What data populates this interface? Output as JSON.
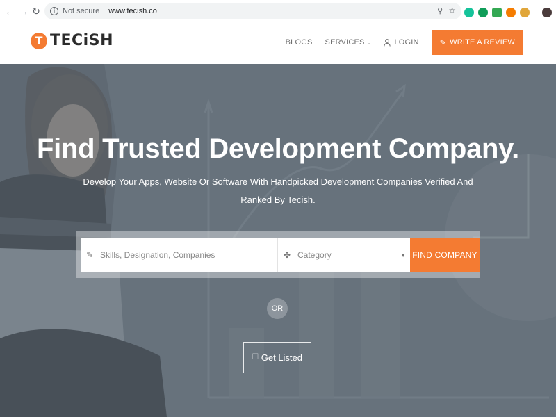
{
  "browser": {
    "security_text": "Not secure",
    "url": "www.tecish.co",
    "icons": [
      "back-icon",
      "forward-icon",
      "reload-icon",
      "info-icon",
      "key-icon",
      "star-icon"
    ]
  },
  "brand": {
    "logo_mark": "T",
    "logo_text": "TECiSH",
    "accent_color": "#f47b32"
  },
  "nav": {
    "blogs": "BLOGS",
    "services": "SERVICES",
    "login": "LOGIN",
    "write_review": "WRITE A REVIEW"
  },
  "hero": {
    "title": "Find Trusted Development Company.",
    "subtitle": "Develop Your Apps, Website Or Software With Handpicked Development Companies Verified And Ranked By Tecish."
  },
  "search": {
    "skills_placeholder": "Skills, Designation, Companies",
    "category_value": "Category",
    "find_button": "FIND COMPANY"
  },
  "divider": {
    "or_text": "OR"
  },
  "cta": {
    "get_listed": "Get Listed"
  }
}
